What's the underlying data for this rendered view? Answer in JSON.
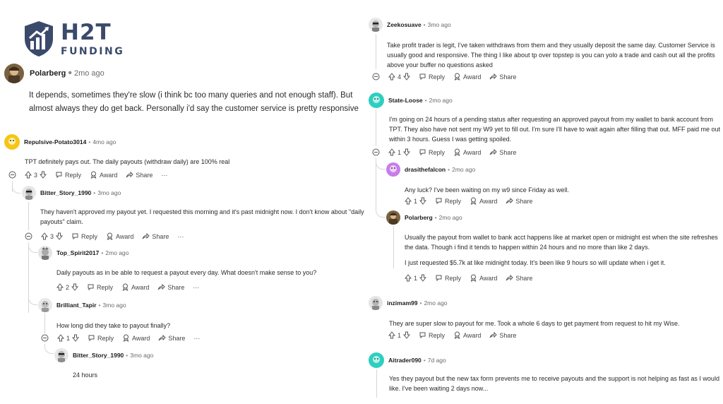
{
  "logo": {
    "main": "H2T",
    "sub": "FUNDING"
  },
  "labels": {
    "reply": "Reply",
    "award": "Award",
    "share": "Share",
    "more": "···"
  },
  "left": [
    {
      "id": "polarberg1",
      "author": "Polarberg",
      "time": "2mo ago",
      "body": "It depends, sometimes they're slow (i think bc too many queries and not enough staff). But almost always they do get back. Personally i'd say the customer service is pretty responsive"
    },
    {
      "id": "repulsive",
      "author": "Repulsive-Potato3014",
      "time": "4mo ago",
      "body": "TPT definitely pays out. The daily payouts (withdraw daily) are 100% real",
      "votes": "3"
    },
    {
      "id": "bitter1",
      "author": "Bitter_Story_1990",
      "time": "3mo ago",
      "body": "They haven't approved my payout yet. I requested this morning and it's past midnight now. I don't know about \"daily payouts\" claim.",
      "votes": "3"
    },
    {
      "id": "topspirit",
      "author": "Top_Spirit2017",
      "time": "2mo ago",
      "body": "Daily payouts as in be able to request a payout every day. What doesn't make sense to you?",
      "votes": "2"
    },
    {
      "id": "tapir",
      "author": "Brilliant_Tapir",
      "time": "3mo ago",
      "body": "How long did they take to payout finally?",
      "votes": "1"
    },
    {
      "id": "bitter2",
      "author": "Bitter_Story_1990",
      "time": "3mo ago",
      "body": "24 hours"
    }
  ],
  "right": [
    {
      "id": "zeeko",
      "author": "Zeekosuave",
      "time": "3mo ago",
      "body": "Take profit trader is legit, I've taken withdraws from them and they usually deposit the same day. Customer Service is usually good and responsive. The thing I like about tp over topstep is you can yolo a trade and cash out all the profits above your buffer no questions asked",
      "votes": "4"
    },
    {
      "id": "stateloose",
      "author": "State-Loose",
      "time": "2mo ago",
      "body": "I'm going on 24 hours of a pending status after requesting an approved payout from my wallet to bank account from TPT. They also have not sent my W9 yet to fill out. I'm sure I'll have to wait again after filling that out. MFF paid me out within 3 hours. Guess I was getting spoiled.",
      "votes": "1"
    },
    {
      "id": "drasi",
      "author": "drasithefalcon",
      "time": "2mo ago",
      "body": "Any luck? I've been waiting on my w9 since Friday as well.",
      "votes": "1"
    },
    {
      "id": "polarberg2",
      "author": "Polarberg",
      "time": "2mo ago",
      "body": "Usually the payout from wallet to bank acct happens like at market open or midnight est when the site refreshes the data. Though i find it tends to happen within 24 hours and no more than like 2 days.",
      "body2": "I just requested $5.7k at like midnight today. It's been like 9 hours so will update when i get it.",
      "votes": "1"
    },
    {
      "id": "inzimam",
      "author": "inzimam99",
      "time": "2mo ago",
      "body": "They are super slow to payout for me. Took a whole 6 days to get payment from request to hit my Wise.",
      "votes": "1"
    },
    {
      "id": "aitrader",
      "author": "Aitrader090",
      "time": "7d ago",
      "body": "Yes they payout but the new tax form prevents me to receive payouts and the support is not helping as fast as I would like. I've been waiting 2 days now..."
    }
  ],
  "colors": {
    "logo": "#3b4a6b",
    "teal_avatar": "#2ecfc0",
    "purple_avatar": "#c77de8",
    "yellow_avatar": "#f5c518"
  }
}
